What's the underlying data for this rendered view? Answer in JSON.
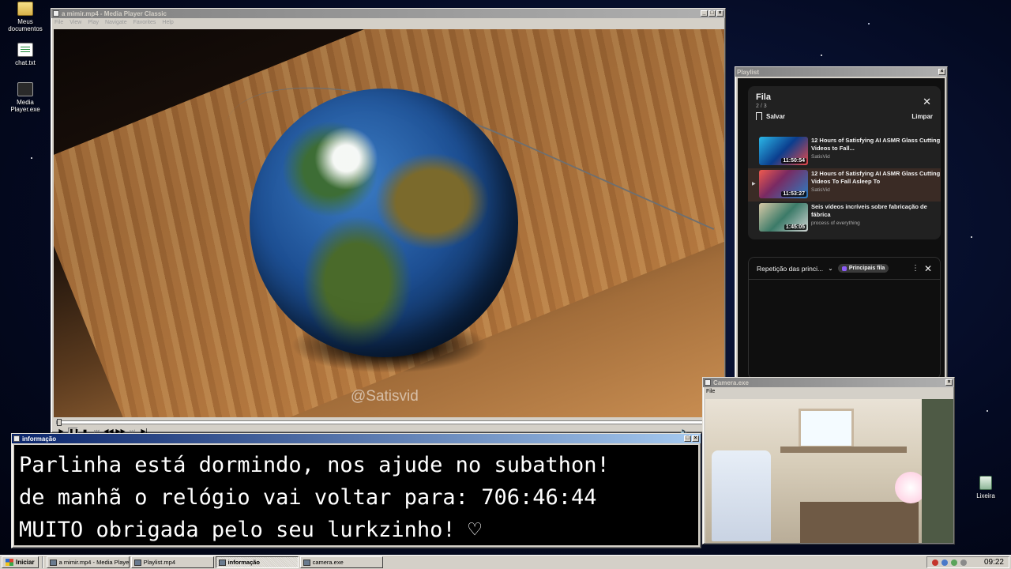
{
  "desktop": {
    "icons": [
      {
        "label": "Meus documentos"
      },
      {
        "label": "chat.txt"
      },
      {
        "label": "Media Player.exe"
      },
      {
        "label": "Lixeira"
      }
    ]
  },
  "media_player": {
    "title": "a mimir.mp4 - Media Player Classic",
    "menu": [
      "File",
      "View",
      "Play",
      "Navigate",
      "Favorites",
      "Help"
    ],
    "watermark": "@Satisvid",
    "controls": {
      "play": "▶",
      "pause": "❚❚",
      "stop": "■",
      "prev": "⏮",
      "rewind": "◀◀",
      "forward": "▶▶",
      "next": "⏭",
      "frame": "▶|"
    },
    "seek_progress": 0.0
  },
  "playlist": {
    "title": "Playlist",
    "queue": {
      "heading": "Fila",
      "position": "2 / 3",
      "save_label": "Salvar",
      "clear_label": "Limpar",
      "items": [
        {
          "title": "12 Hours of Satisfying AI ASMR Glass Cutting Videos to Fall...",
          "channel": "SatisVid",
          "duration": "11:50:54",
          "current": false
        },
        {
          "title": "12 Hours of Satisfying AI ASMR Glass Cutting Videos To Fall Asleep To",
          "channel": "SatisVid",
          "duration": "11:53:27",
          "current": true
        },
        {
          "title": "Seis vídeos incríveis sobre fabricação de fábrica",
          "channel": "process of everything",
          "duration": "1:45:05",
          "current": false
        }
      ]
    },
    "repeat_bar": {
      "label": "Repetição das princi...",
      "chip": "Principais fila"
    }
  },
  "info": {
    "title": "informação",
    "lines": [
      "Parlinha está dormindo, nos ajude no subathon!",
      "de manhã o relógio vai voltar para:  706:46:44",
      "MUITO obrigada pelo seu lurkzinho! ♡"
    ]
  },
  "camera": {
    "title": "Camera.exe",
    "menu": [
      "File"
    ]
  },
  "taskbar": {
    "start_label": "Iniciar",
    "tasks": [
      {
        "label": "a mimir.mp4 - Media Player...",
        "active": false
      },
      {
        "label": "Playlist.mp4",
        "active": false
      },
      {
        "label": "informação",
        "active": true
      },
      {
        "label": "camera.exe",
        "active": false
      }
    ],
    "clock": "09:22"
  },
  "colors": {
    "title_active": "#0a246a",
    "title_inactive": "#808080",
    "window_face": "#d4d0c8",
    "queue_current": "#3a2b25"
  }
}
